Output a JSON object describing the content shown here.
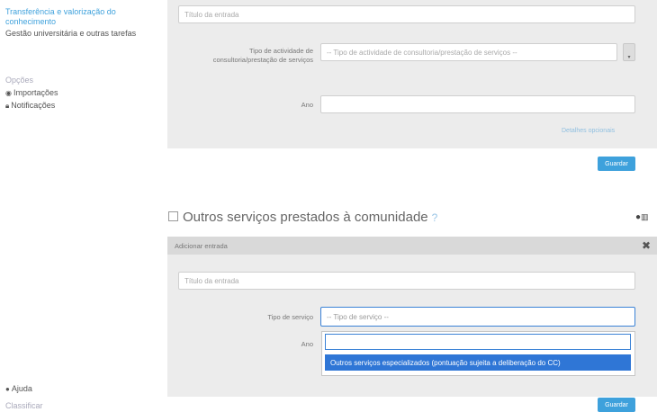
{
  "sidebar": {
    "active_link": "Transferência e valorização do conhecimento",
    "item_gestao": "Gestão universitária e outras tarefas",
    "section_label": "Opções",
    "importacoes": "Importações",
    "notificacoes": "Notificações",
    "help": "Ajuda",
    "bottom_label": "Classificar"
  },
  "top_form": {
    "title_placeholder": "Título da entrada",
    "activity_type_label": "Tipo de actividade de consultoria/prestação de serviços",
    "activity_type_placeholder": "-- Tipo de actividade de consultoria/prestação de serviços --",
    "year_label": "Ano",
    "more_link": "Detalhes opcionais",
    "save_button": "Guardar"
  },
  "section": {
    "title": "Outros serviços prestados à comunidade",
    "help_mark": "?"
  },
  "bottom_form": {
    "header": "Adicionar entrada",
    "title_placeholder": "Título da entrada",
    "service_type_label": "Tipo de serviço",
    "service_type_placeholder": "-- Tipo de serviço --",
    "year_label": "Ano",
    "option_highlighted": "Outros serviços especializados (pontuação sujeita a deliberação do CC)",
    "save_button": "Guardar"
  }
}
